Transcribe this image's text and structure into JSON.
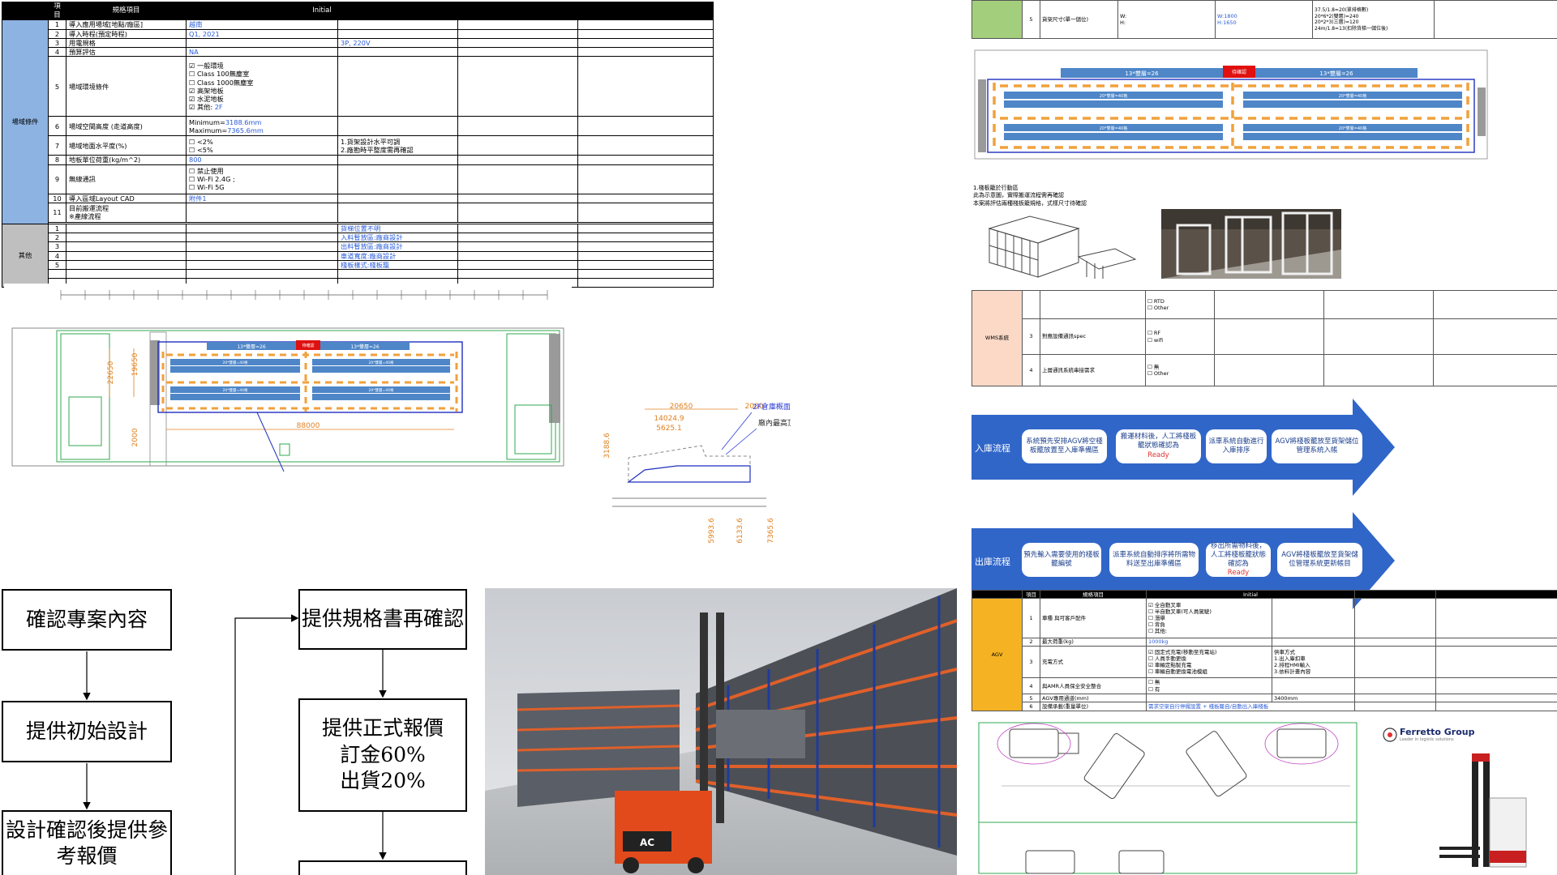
{
  "spec_table": {
    "headers": [
      "項目",
      "規格項目",
      "Initial"
    ],
    "category_site": "場域條件",
    "category_other": "其他",
    "rows": [
      {
        "no": "1",
        "item": "導入應用場域[地點/廠區]",
        "initial": "越南",
        "note": ""
      },
      {
        "no": "2",
        "item": "導入時程(預定時程)",
        "initial": "Q1, 2021",
        "note": ""
      },
      {
        "no": "3",
        "item": "用電規格",
        "initial": "",
        "note": "3P, 220V"
      },
      {
        "no": "4",
        "item": "預算評估",
        "initial": "NA",
        "note": ""
      },
      {
        "no": "5",
        "item": "場域環境條件",
        "initial_lines": [
          "☑ 一般環境",
          "☐ Class 100無塵室",
          "☐ Class 1000無塵室",
          "☑ 高架地板",
          "☑ 水泥地板",
          "☑ 其他: "
        ],
        "initial_extra": "2F",
        "note": ""
      },
      {
        "no": "6",
        "item": "場域空間高度 (走道高度)",
        "initial_lines": [
          "Minimum=",
          "Maximum="
        ],
        "initial_vals": [
          "3188.6mm",
          "7365.6mm"
        ],
        "note": ""
      },
      {
        "no": "7",
        "item": "場域地面水平度(%)",
        "initial_lines": [
          "☐ <2%",
          "☐ <5%"
        ],
        "note_lines": [
          "1.貨架設計水平可調",
          "2.廠勘時平整度需再確認"
        ]
      },
      {
        "no": "8",
        "item": "地板單位荷重(kg/m^2)",
        "initial": "800",
        "note": ""
      },
      {
        "no": "9",
        "item": "無線通訊",
        "initial_lines": [
          "☐ 禁止使用",
          "☐ Wi-Fi 2.4G ;",
          "☐ Wi-Fi 5G"
        ],
        "note": ""
      },
      {
        "no": "10",
        "item": "導入區域Layout CAD",
        "initial": "附件1",
        "note": ""
      },
      {
        "no": "11",
        "item_lines": [
          "目前搬運流程",
          "※產線流程"
        ],
        "initial": "",
        "note": ""
      }
    ],
    "other_rows": [
      {
        "no": "1",
        "note": "貨梯位置不明"
      },
      {
        "no": "2",
        "note": "入料暫放區:廠商設計"
      },
      {
        "no": "3",
        "note": "出料暫放區:廠商設計"
      },
      {
        "no": "4",
        "note": "車道寬度:廠商設計"
      },
      {
        "no": "5",
        "note": "棧板樣式:棧板籠"
      }
    ]
  },
  "layout_drawing": {
    "rack_top": "13*雙層=26",
    "rack_top2": "13*雙層=26",
    "rack_mid": "20*雙層=40格",
    "dim_height": "22650",
    "dim_height2": "19650",
    "dim_width": "88000",
    "dim_small": "2000",
    "elevator_label": "待確認"
  },
  "section_drawing": {
    "dims": [
      "20650",
      "2000",
      "14024.9",
      "5625.1"
    ],
    "label_2f": "2F倉庫概面",
    "label_roof": "廠內最高頂部",
    "dims_vertical": [
      "3188.6",
      "5993.6",
      "6133.6",
      "7365.6"
    ]
  },
  "flow_left": {
    "box1": "確認專案內容",
    "box2": "提供初始設計",
    "box3": "設計確認後提供參考報價",
    "box4": "提供規格書再確認",
    "box5_lines": [
      "提供正式報價",
      "訂金60%",
      "出貨20%"
    ]
  },
  "top_right_table": {
    "no": "5",
    "item": "貨架尺寸(單一儲位)",
    "w_label": "W:",
    "h_label": "H:",
    "w_val": "W:1800",
    "h_val": "H:1650",
    "note_lines": [
      "37.5/1.8=20(單排格數)",
      "20*6*2(雙層)=240",
      "20*2*3(三層)=120",
      "24m/1.8=13(扣除貨梯一儲位後)"
    ]
  },
  "pallet_note": {
    "lines": [
      "1.棧板籠於行動區",
      "此為示意圖，實際搬運流程需再確認",
      "本案將評估兩種棧板籠規格，式樣尺寸待確認"
    ]
  },
  "wms_table": {
    "category": "WMS系統",
    "rows": [
      {
        "no": "",
        "item": "",
        "opts": [
          "☐ RTD",
          "☐ Other"
        ]
      },
      {
        "no": "3",
        "item": "對應設備通訊spec",
        "opts": [
          "☐ RF",
          "☐ wifi"
        ]
      },
      {
        "no": "4",
        "item": "上層通訊系統串接需求",
        "opts": [
          "☐ 無",
          "☐ Other"
        ]
      }
    ]
  },
  "process_in": {
    "label": "入庫流程",
    "steps": [
      "系統預先安排AGV將空棧板籠放置至入庫準備區",
      "搬運材料後，人工將棧板籠狀態確認為",
      "派車系統自動進行入庫排序",
      "AGV將棧板籠放至貨架儲位管理系統入帳"
    ],
    "ready": "Ready"
  },
  "process_out": {
    "label": "出庫流程",
    "steps": [
      "預先輸入需要使用的棧板籠編號",
      "派車系統自動排序將所需物料送至出庫準備區",
      "移出所需物料後，人工將棧板籠狀態確認為",
      "AGV將棧板籠放至貨架儲位管理系統更新帳目"
    ],
    "ready": "Ready"
  },
  "agv_table": {
    "headers": [
      "項目",
      "規格項目",
      "Initial"
    ],
    "category": "AGV",
    "rows": [
      {
        "no": "1",
        "item": "車種\n與可客戶配件",
        "lines": [
          "☑ 全自動叉車",
          "☐ 半自動叉車(可人員駕駛)",
          "☐ 潛舉",
          "☐ 背負",
          "☐ 其他:"
        ],
        "note": ""
      },
      {
        "no": "2",
        "item": "最大荷重(kg)",
        "lines": [
          "1000kg"
        ],
        "note": ""
      },
      {
        "no": "3",
        "item": "充電方式",
        "lines": [
          "☑ 固定式充電(移動至充電站)",
          "☐ 人員手動更換",
          "☑ 車輛定點製充電",
          "☐ 車輛自動更換電池模組"
        ],
        "note_lines": [
          "供車方式",
          "1.出入庫扣車",
          "2.排程HMI輸入",
          "3.依料計畫內容"
        ]
      },
      {
        "no": "4",
        "item": "與AMR人員保全安全整合",
        "lines": [
          "☐ 無",
          "☐ 有"
        ],
        "note": ""
      },
      {
        "no": "5",
        "item": "AGV專用通道(mm)",
        "lines": [
          ""
        ],
        "note": "3400mm"
      },
      {
        "no": "6",
        "item": "設備承載(重量單位)",
        "lines": [
          "需求空架自行停擺設置 + 棧板籠自/自動出入庫棧板"
        ],
        "note": ""
      }
    ]
  },
  "logo": {
    "name": "Ferretto Group",
    "tagline": "Leader in logistic solutions"
  },
  "photo_forklift_text": "AC",
  "colors": {
    "table_blue": "#8db3e2",
    "table_gray": "#bfbfbf",
    "arrow_blue": "#3166c9",
    "rack_blue": "#4e86c8",
    "accent_orange": "#f0a13c",
    "agv_yellow": "#f5b324",
    "green_header": "#a3cf7d"
  }
}
